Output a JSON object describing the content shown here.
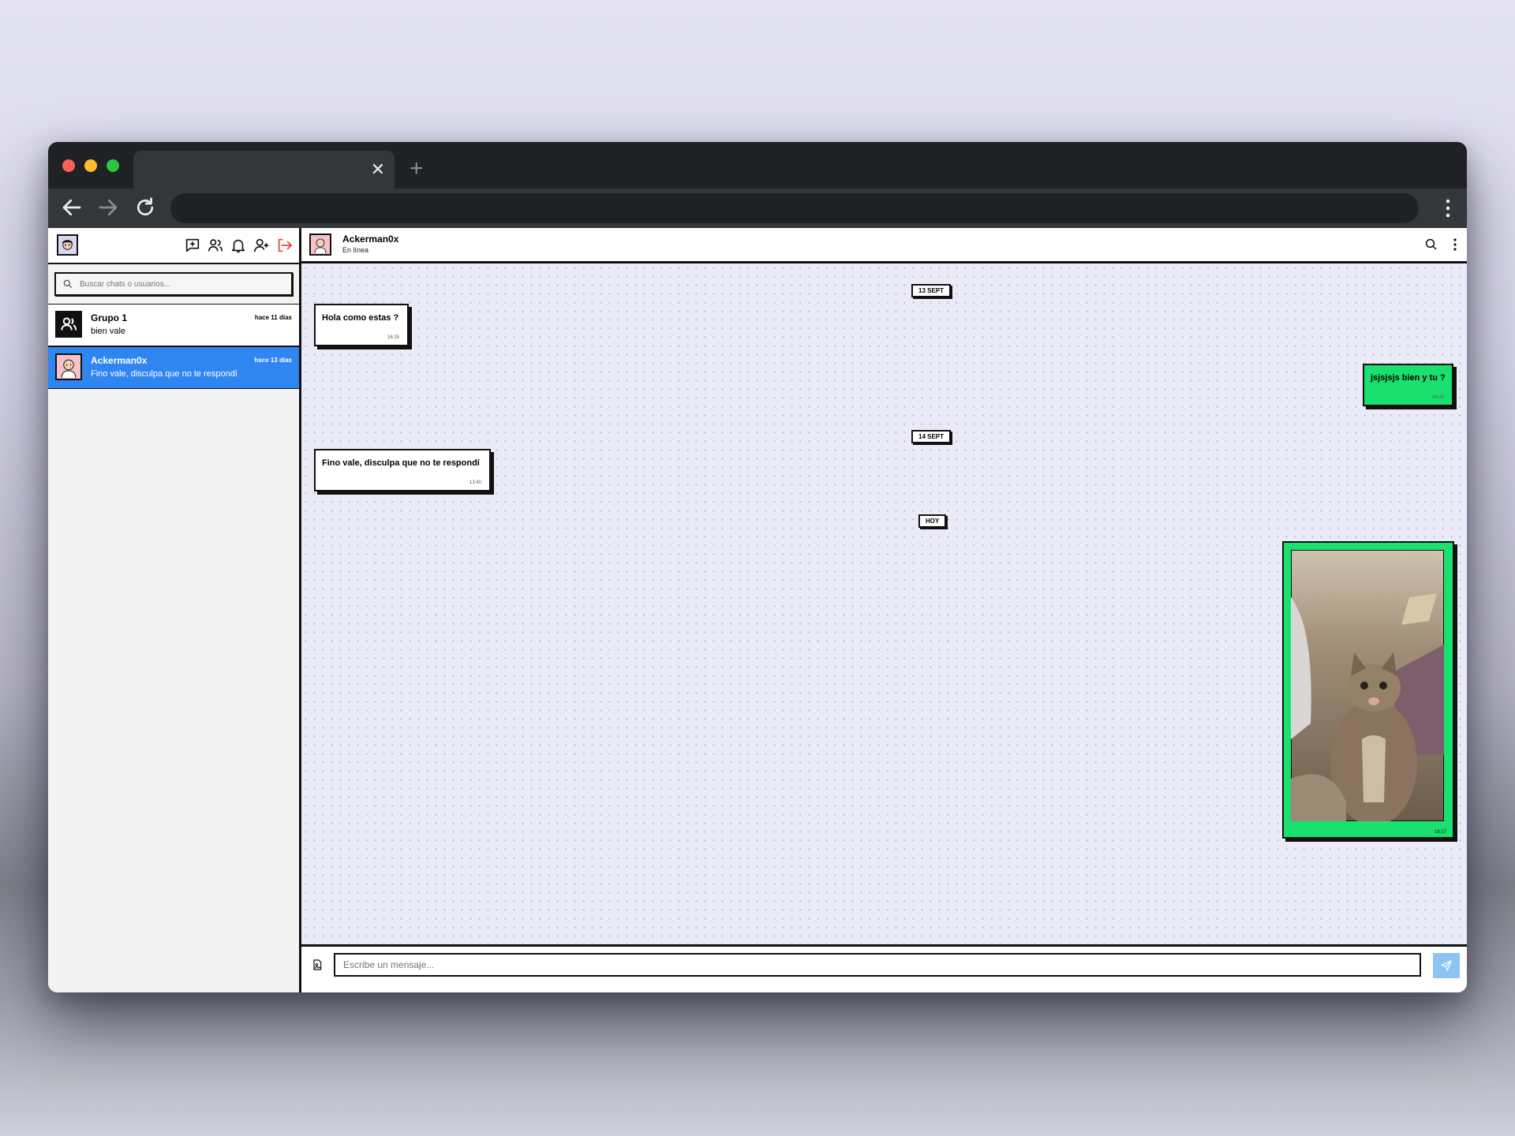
{
  "browser": {
    "tab_close": "✕",
    "new_tab": "+"
  },
  "sidebar": {
    "search_placeholder": "Buscar chats o usuarios...",
    "chats": [
      {
        "name": "Grupo 1",
        "last_message": "bien vale",
        "time": "hace 11 días",
        "active": false
      },
      {
        "name": "Ackerman0x",
        "last_message": "Fino vale, disculpa que no te respondí",
        "time": "hace 13 días",
        "active": true
      }
    ]
  },
  "chat": {
    "contact_name": "Ackerman0x",
    "contact_status": "En línea",
    "date_separators": [
      "13 SEPT",
      "14 SEPT",
      "HOY"
    ],
    "messages": [
      {
        "direction": "in",
        "text": "Hola como estas ?",
        "time": "16:15"
      },
      {
        "direction": "out",
        "text": "jsjsjsjs bien y tu ?",
        "time": "16:15"
      },
      {
        "direction": "in",
        "text": "Fino vale, disculpa que no te respondí",
        "time": "13:40"
      },
      {
        "direction": "out",
        "type": "image",
        "image": "cat-photo",
        "time": "19:17"
      }
    ],
    "composer_placeholder": "Escribe un mensaje..."
  },
  "colors": {
    "accent_blue": "#2f86f0",
    "sent_bubble": "#19e06e",
    "send_button": "#8ec4f4",
    "logout_icon": "#e0433f"
  }
}
